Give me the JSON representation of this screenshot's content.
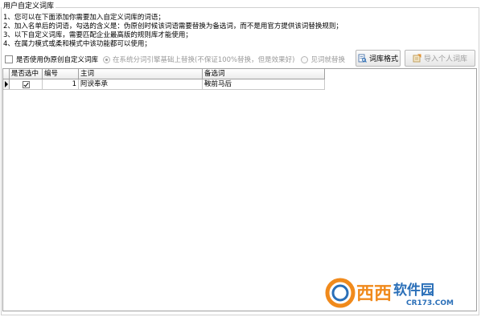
{
  "group_title": "用户自定义词库",
  "instructions": [
    "1、您可以在下面添加你需要加入自定义词库的词语；",
    "2、加入名单后的词语，勾选的含义是：伪原创时候该词语需要替换为备选词，而不是用官方提供该词替换规则；",
    "3、以下自定义词库，需要匹配企业最高版的规则库才能使用；",
    "4、在属力模式或柔和模式中该功能都可以使用；"
  ],
  "options": {
    "use_custom_label": "是否使用伪原创自定义词库",
    "radio_system_label": "在系统分词引擎基础上替换(不保证100%替换，但是效果好)",
    "radio_direct_label": "见词就替换"
  },
  "buttons": {
    "format_label": "词库格式",
    "import_label": "导入个人词库"
  },
  "grid": {
    "columns": [
      "是否选中",
      "编号",
      "主词",
      "备选词"
    ],
    "rows": [
      {
        "checked": true,
        "id": "1",
        "main": "阿谀奉承",
        "alt": "鞍前马后"
      }
    ]
  },
  "watermark": {
    "brand": "西西",
    "brand2": "软件园",
    "url": "CR173.COM"
  },
  "colors": {
    "watermark_orange": "#f08a1c",
    "watermark_blue": "#2a6fb8"
  }
}
